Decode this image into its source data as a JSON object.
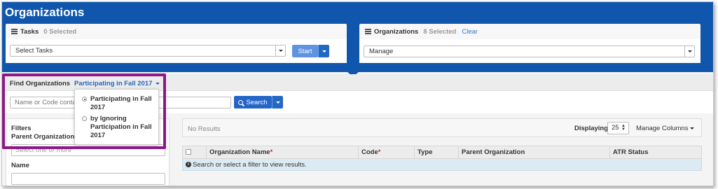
{
  "page": {
    "title": "Organizations"
  },
  "tasks_panel": {
    "title": "Tasks",
    "count": "0 Selected",
    "select_value": "Select Tasks",
    "start_label": "Start"
  },
  "orgs_panel": {
    "title": "Organizations",
    "count": "8 Selected",
    "clear_label": "Clear",
    "select_value": "Manage"
  },
  "find": {
    "label": "Find Organizations",
    "dropdown_value": "Participating in Fall 2017",
    "options": [
      {
        "label": "Participating in Fall 2017",
        "selected": true
      },
      {
        "label": "by Ignoring Participation in Fall 2017",
        "selected": false
      }
    ],
    "search_placeholder": "Name or Code contains",
    "search_label": "Search"
  },
  "filters": {
    "title": "Filters",
    "parent_label": "Parent Organization",
    "parent_placeholder": "Select one or more",
    "name_label": "Name"
  },
  "results": {
    "status": "No Results",
    "displaying_label": "Displaying",
    "per_page": "25",
    "manage_columns": "Manage Columns",
    "columns": [
      {
        "label": "Organization Name",
        "required": true
      },
      {
        "label": "Code",
        "required": true
      },
      {
        "label": "Type",
        "required": false
      },
      {
        "label": "Parent Organization",
        "required": false
      },
      {
        "label": "ATR Status",
        "required": false
      }
    ],
    "empty_message": "Search or select a filter to view results."
  },
  "colors": {
    "header_blue": "#0f56ac",
    "link_blue": "#2466b8",
    "highlight_purple": "#8f1787",
    "row_info": "#dcebf3"
  }
}
